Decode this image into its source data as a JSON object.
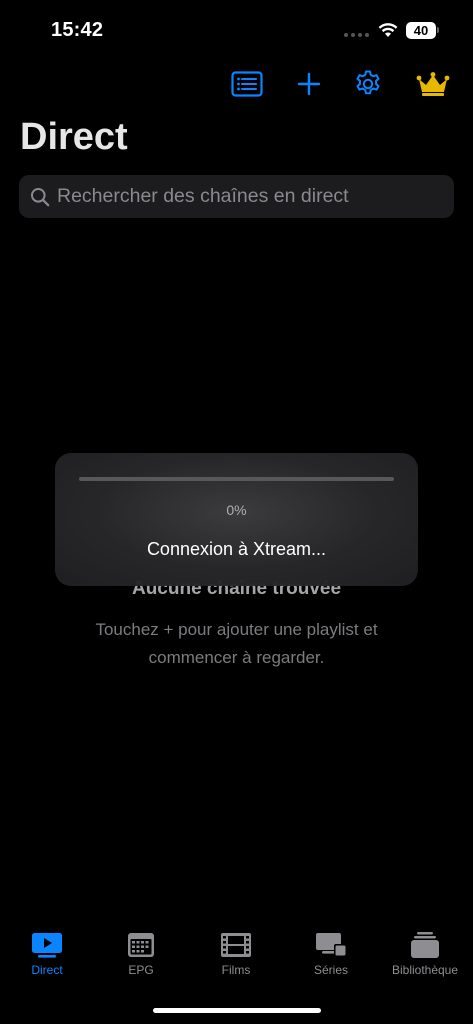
{
  "status_bar": {
    "time": "15:42",
    "battery": "40"
  },
  "toolbar": {
    "list_icon": "list-icon",
    "add_icon": "plus-icon",
    "settings_icon": "gear-icon",
    "premium_icon": "crown-icon"
  },
  "page": {
    "title": "Direct"
  },
  "search": {
    "placeholder": "Rechercher des chaînes en direct",
    "value": ""
  },
  "empty_state": {
    "title": "Aucune chaîne trouvée",
    "message": "Touchez + pour ajouter une playlist et commencer à regarder."
  },
  "loading": {
    "progress_percent": 0,
    "progress_label": "0%",
    "message": "Connexion à Xtream..."
  },
  "tabs": [
    {
      "label": "Direct",
      "icon": "tv-play-icon",
      "active": true
    },
    {
      "label": "EPG",
      "icon": "calendar-grid-icon",
      "active": false
    },
    {
      "label": "Films",
      "icon": "film-strip-icon",
      "active": false
    },
    {
      "label": "Séries",
      "icon": "tv-devices-icon",
      "active": false
    },
    {
      "label": "Bibliothèque",
      "icon": "library-stack-icon",
      "active": false
    }
  ],
  "colors": {
    "accent": "#0a84ff",
    "premium": "#e6b800",
    "background": "#000000"
  }
}
